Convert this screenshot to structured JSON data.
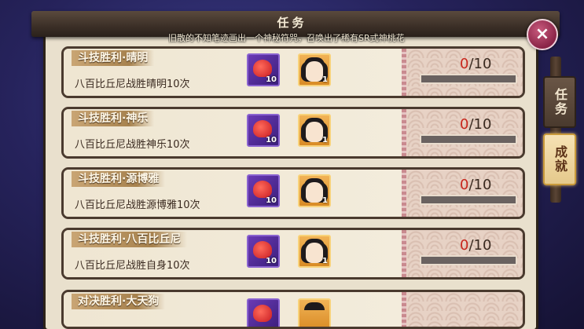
{
  "window": {
    "title": "任务",
    "story": "旧散的不知笔迹画出一个神秘符咒，召唤出了稀有SR式神桃花"
  },
  "side_tabs": [
    {
      "label": "任务",
      "active": false
    },
    {
      "label": "成就",
      "active": true
    }
  ],
  "close_icon": "×",
  "tasks": [
    {
      "title": "斗技胜利·晴明",
      "desc": "八百比丘尼战胜晴明10次",
      "talisman_qty": "10",
      "char_qty": "1",
      "progress_current": "0",
      "progress_total": "/10",
      "progress_fraction": 0
    },
    {
      "title": "斗技胜利·神乐",
      "desc": "八百比丘尼战胜神乐10次",
      "talisman_qty": "10",
      "char_qty": "1",
      "progress_current": "0",
      "progress_total": "/10",
      "progress_fraction": 0
    },
    {
      "title": "斗技胜利·源博雅",
      "desc": "八百比丘尼战胜源博雅10次",
      "talisman_qty": "10",
      "char_qty": "1",
      "progress_current": "0",
      "progress_total": "/10",
      "progress_fraction": 0
    },
    {
      "title": "斗技胜利·八百比丘尼",
      "desc": "八百比丘尼战胜自身10次",
      "talisman_qty": "10",
      "char_qty": "1",
      "progress_current": "0",
      "progress_total": "/10",
      "progress_fraction": 0
    },
    {
      "title": "对决胜利·大天狗"
    }
  ],
  "colors": {
    "accent_red": "#c8261c",
    "frame_dark": "#4a3a2e",
    "parchment": "#e9e0cd"
  },
  "icons": {
    "reward_1": "red-talisman-icon",
    "reward_2": "shikigami-portrait-icon",
    "close": "close-icon"
  }
}
